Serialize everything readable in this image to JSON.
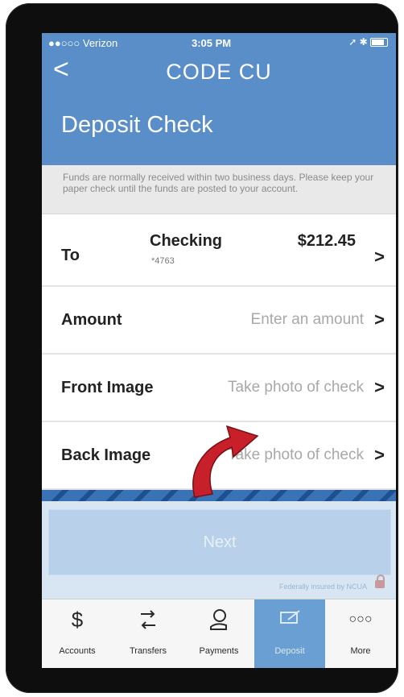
{
  "status_bar": {
    "carrier": "●●○○○ Verizon",
    "time": "3:05 PM"
  },
  "nav": {
    "back_icon": "chevron-left",
    "title": "CODE CU"
  },
  "page": {
    "heading": "Deposit Check"
  },
  "notice": "Funds are normally received within two business days. Please keep your paper check until the funds are posted to your account.",
  "form": {
    "to": {
      "label": "To",
      "account_name": "Checking",
      "account_number": "*4763",
      "balance": "$212.45"
    },
    "amount": {
      "label": "Amount",
      "placeholder": "Enter an amount"
    },
    "front_image": {
      "label": "Front Image",
      "placeholder": "Take photo of check"
    },
    "back_image": {
      "label": "Back Image",
      "placeholder": "Take photo of check"
    }
  },
  "submit_label": "Next",
  "insured_text": "Federally insured by NCUA",
  "tabs": [
    {
      "label": "Accounts",
      "icon": "dollar-icon"
    },
    {
      "label": "Transfers",
      "icon": "transfer-icon"
    },
    {
      "label": "Payments",
      "icon": "payments-icon"
    },
    {
      "label": "Deposit",
      "icon": "deposit-icon",
      "active": true
    },
    {
      "label": "More",
      "icon": "more-icon"
    }
  ],
  "colors": {
    "header_blue": "#5a8ec9",
    "active_tab": "#6a9fd4",
    "arrow_red": "#c8202a"
  }
}
